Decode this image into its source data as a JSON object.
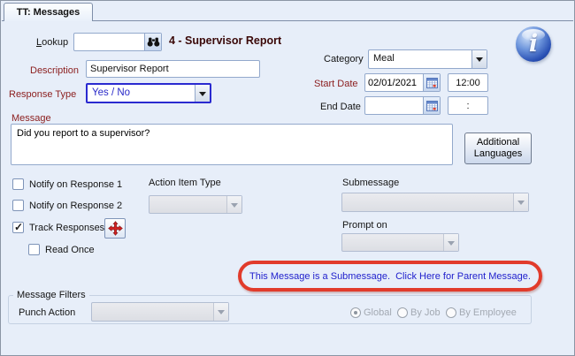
{
  "tab": {
    "label": "TT: Messages"
  },
  "lookup": {
    "label_accel": "L",
    "label_rest": "ookup",
    "value": ""
  },
  "record_title": "4 - Supervisor Report",
  "info_icon": {
    "glyph": "i"
  },
  "fields": {
    "description": {
      "label": "Description",
      "value": "Supervisor Report"
    },
    "category": {
      "label": "Category",
      "value": "Meal"
    },
    "response_type": {
      "label": "Response Type",
      "value": "Yes / No"
    },
    "start_date": {
      "label": "Start Date",
      "date": "02/01/2021",
      "time": "12:00"
    },
    "end_date": {
      "label": "End Date",
      "date": "",
      "time": ":"
    },
    "message": {
      "label": "Message",
      "value": "Did you report to a supervisor?"
    }
  },
  "buttons": {
    "additional_languages_line1": "Additional",
    "additional_languages_line2": "Languages"
  },
  "checkboxes": {
    "notify1": {
      "label": "Notify on Response 1",
      "checked": false
    },
    "notify2": {
      "label": "Notify on Response 2",
      "checked": false
    },
    "track_responses": {
      "label": "Track Responses",
      "checked": true
    },
    "read_once": {
      "label": "Read Once",
      "checked": false
    }
  },
  "dropdowns": {
    "action_item_type": {
      "label": "Action Item Type",
      "value": ""
    },
    "submessage": {
      "label": "Submessage",
      "value": ""
    },
    "prompt_on": {
      "label": "Prompt on",
      "value": ""
    },
    "punch_action": {
      "label": "Punch Action",
      "value": ""
    }
  },
  "submessage_link": {
    "text": "This Message is a Submessage.  Click Here for Parent Message."
  },
  "filters": {
    "group_label": "Message Filters",
    "radios": {
      "global": {
        "label": "Global",
        "selected": true
      },
      "by_job": {
        "label": "By Job",
        "selected": false
      },
      "by_employee": {
        "label": "By Employee",
        "selected": false
      }
    }
  },
  "colors": {
    "label_maroon": "#8b1d1d",
    "link_blue": "#2121cd",
    "annotation_red": "#e13b2b",
    "focus_blue": "#2a2ad0",
    "window_bg": "#e7eef9"
  }
}
